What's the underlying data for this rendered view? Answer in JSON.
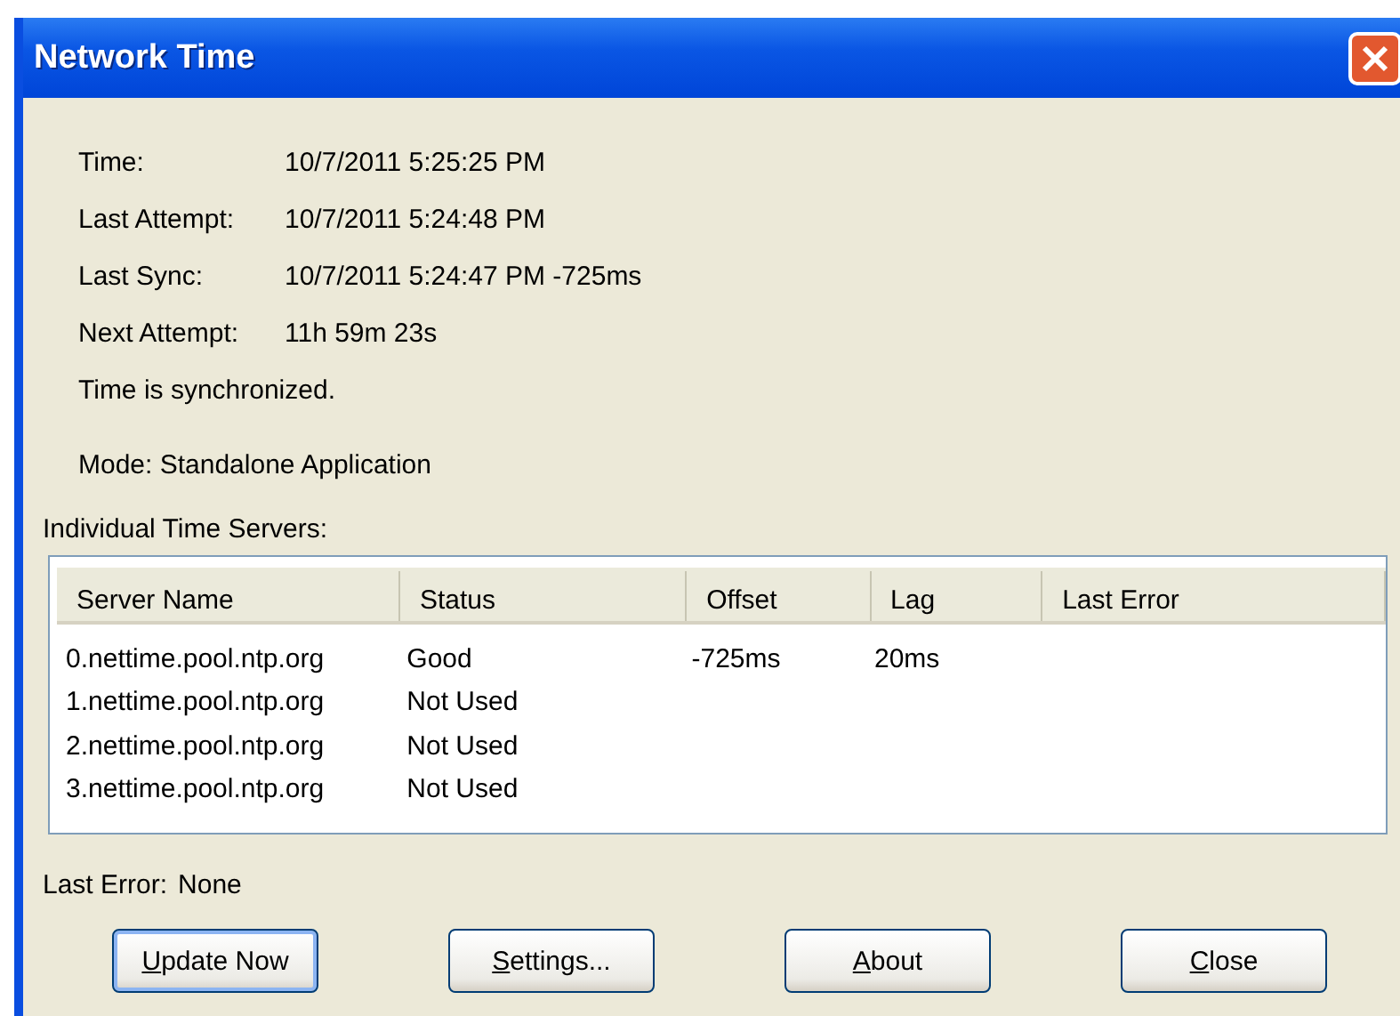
{
  "window": {
    "title": "Network Time"
  },
  "info": [
    {
      "label": "Time:",
      "value": "10/7/2011 5:25:25 PM"
    },
    {
      "label": "Last Attempt:",
      "value": "10/7/2011 5:24:48 PM"
    },
    {
      "label": "Last Sync:",
      "value": "10/7/2011 5:24:47 PM -725ms"
    },
    {
      "label": "Next Attempt:",
      "value": "11h 59m 23s"
    }
  ],
  "sync_status": "Time is synchronized.",
  "mode": "Mode: Standalone Application",
  "servers_label": "Individual Time Servers:",
  "table": {
    "columns": [
      "Server Name",
      "Status",
      "Offset",
      "Lag",
      "Last Error"
    ],
    "rows": [
      [
        "0.nettime.pool.ntp.org",
        "Good",
        "-725ms",
        "20ms",
        ""
      ],
      [
        "1.nettime.pool.ntp.org",
        "Not Used",
        "",
        "",
        ""
      ],
      [
        "2.nettime.pool.ntp.org",
        "Not Used",
        "",
        "",
        ""
      ],
      [
        "3.nettime.pool.ntp.org",
        "Not Used",
        "",
        "",
        ""
      ]
    ]
  },
  "last_error": {
    "label": "Last Error:",
    "value": "None"
  },
  "buttons": [
    {
      "label": "Update Now",
      "default": true
    },
    {
      "label": "Settings...",
      "default": false
    },
    {
      "label": "About",
      "default": false
    },
    {
      "label": "Close",
      "default": false
    }
  ]
}
